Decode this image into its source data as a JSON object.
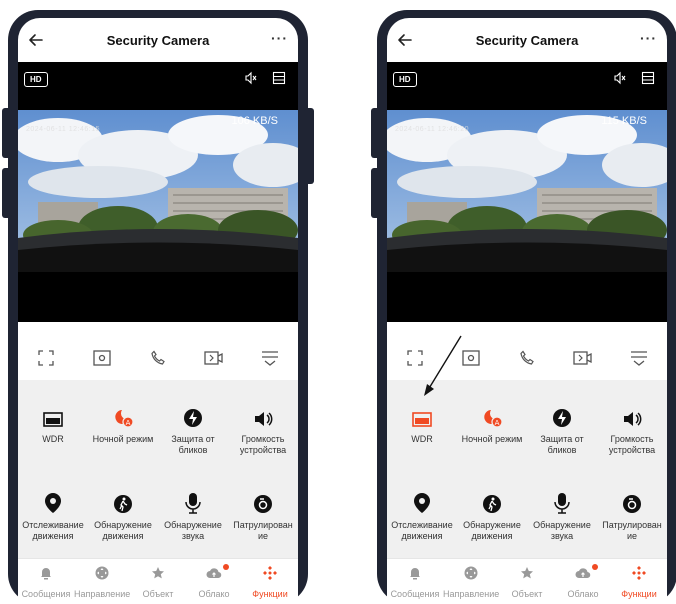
{
  "screens": [
    {
      "title": "Security Camera",
      "more": "···",
      "hd_label": "HD",
      "speed": "106 KB/S",
      "osd": "2024-06-11 12:46:15",
      "features": [
        {
          "label": "WDR",
          "icon": "wdr-icon",
          "active": false
        },
        {
          "label": "Ночной режим",
          "icon": "night-mode-icon",
          "active": true
        },
        {
          "label": "Защита от бликов",
          "icon": "anti-flicker-icon",
          "active": false
        },
        {
          "label": "Громкость устройства",
          "icon": "volume-icon",
          "active": false
        },
        {
          "label": "Отслеживание движения",
          "icon": "location-pin-icon",
          "active": false
        },
        {
          "label": "Обнаружение движения",
          "icon": "walking-person-icon",
          "active": false
        },
        {
          "label": "Обнаружение звука",
          "icon": "microphone-icon",
          "active": false
        },
        {
          "label": "Патрулирован ие",
          "icon": "patrol-icon",
          "active": false
        }
      ],
      "tabs": [
        {
          "label": "Сообщения",
          "icon": "bell-icon"
        },
        {
          "label": "Направление",
          "icon": "joystick-icon"
        },
        {
          "label": "Объект",
          "icon": "star-icon"
        },
        {
          "label": "Облако",
          "icon": "cloud-icon"
        },
        {
          "label": "Функции",
          "icon": "functions-icon"
        }
      ]
    },
    {
      "title": "Security Camera",
      "more": "···",
      "hd_label": "HD",
      "speed": "115 KB/S",
      "osd": "2024-06-11 12:46:20",
      "features": [
        {
          "label": "WDR",
          "icon": "wdr-icon",
          "active": true
        },
        {
          "label": "Ночной режим",
          "icon": "night-mode-icon",
          "active": true
        },
        {
          "label": "Защита от бликов",
          "icon": "anti-flicker-icon",
          "active": false
        },
        {
          "label": "Громкость устройства",
          "icon": "volume-icon",
          "active": false
        },
        {
          "label": "Отслеживание движения",
          "icon": "location-pin-icon",
          "active": false
        },
        {
          "label": "Обнаружение движения",
          "icon": "walking-person-icon",
          "active": false
        },
        {
          "label": "Обнаружение звука",
          "icon": "microphone-icon",
          "active": false
        },
        {
          "label": "Патрулирован ие",
          "icon": "patrol-icon",
          "active": false
        }
      ],
      "tabs": [
        {
          "label": "Сообщения",
          "icon": "bell-icon"
        },
        {
          "label": "Направление",
          "icon": "joystick-icon"
        },
        {
          "label": "Объект",
          "icon": "star-icon"
        },
        {
          "label": "Облако",
          "icon": "cloud-icon"
        },
        {
          "label": "Функции",
          "icon": "functions-icon"
        }
      ]
    }
  ],
  "colors": {
    "accent": "#f04a23",
    "dark": "#1f2433",
    "icon_gray": "#555555"
  }
}
